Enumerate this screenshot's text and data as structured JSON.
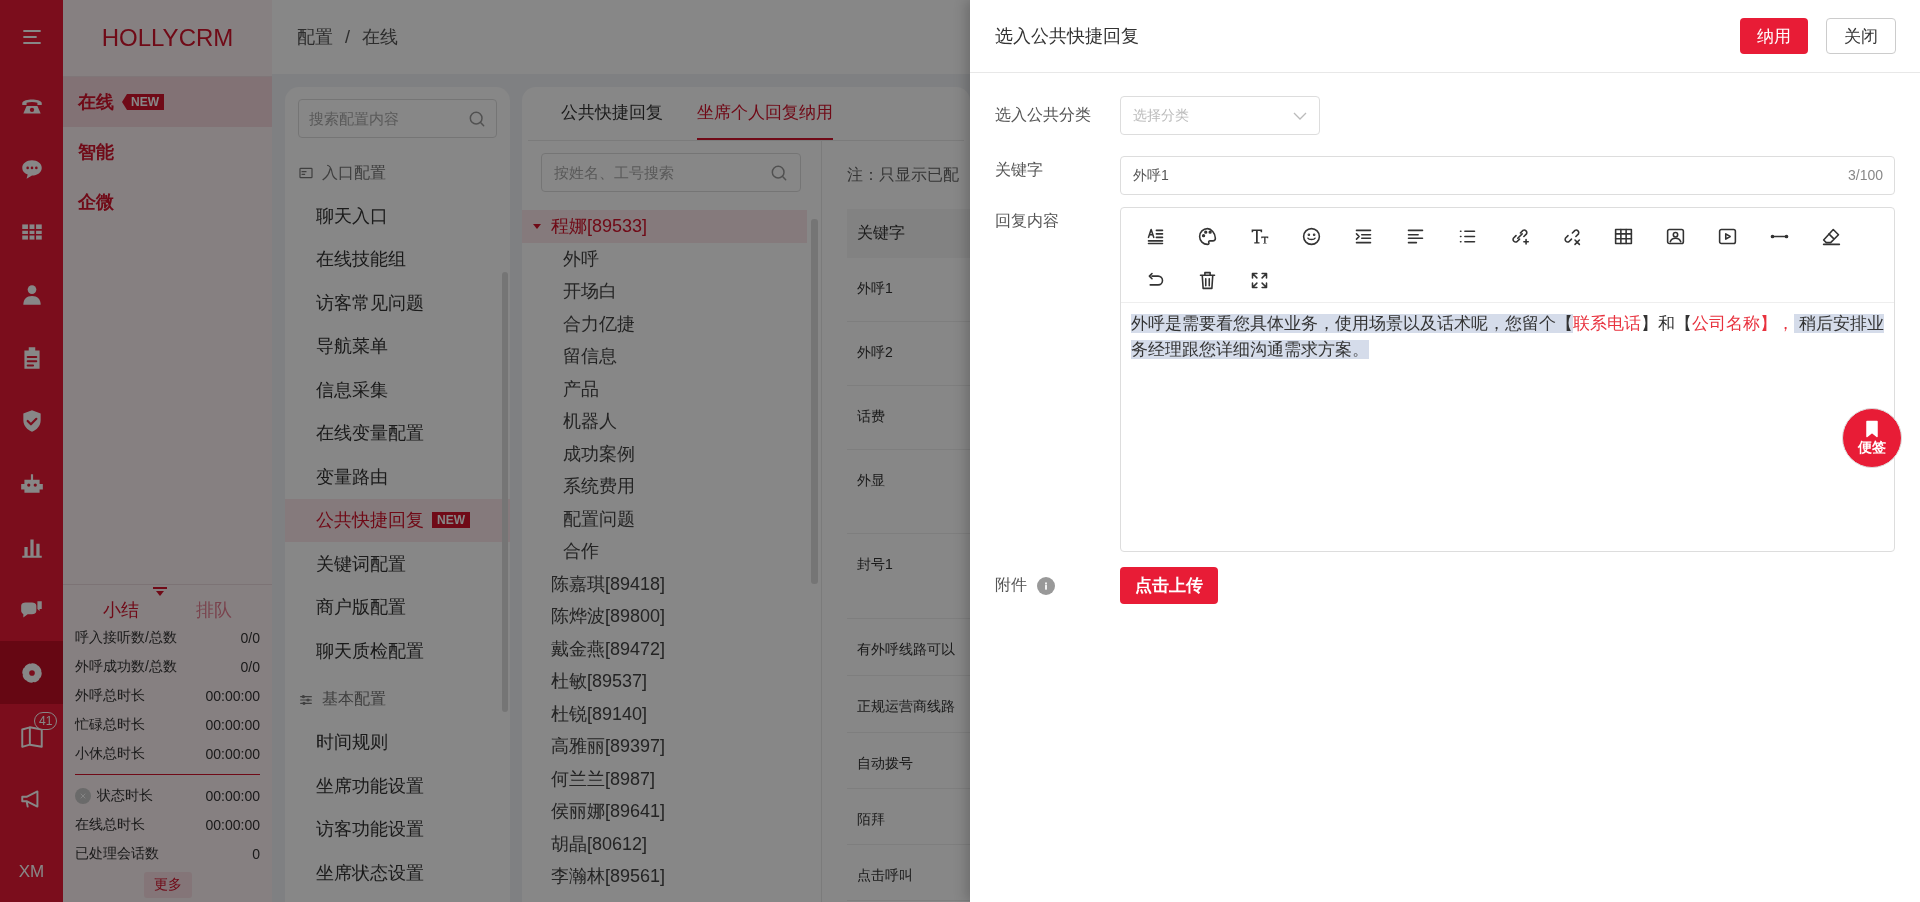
{
  "rail": {
    "items": [
      {
        "selected": false
      },
      {
        "selected": false
      },
      {
        "selected": false
      },
      {
        "selected": false
      },
      {
        "selected": false
      },
      {
        "selected": false
      },
      {
        "selected": false
      },
      {
        "selected": false
      },
      {
        "selected": false
      },
      {
        "selected": true
      },
      {
        "selected": false,
        "badge": "41"
      },
      {
        "selected": false
      }
    ],
    "user": "XM"
  },
  "side": {
    "logo": "HOLLYCRM",
    "items": [
      {
        "label": "在线",
        "badge": "NEW",
        "selected": true
      },
      {
        "label": "智能",
        "selected": false
      },
      {
        "label": "企微",
        "selected": false
      }
    ],
    "stats": {
      "tabs": [
        {
          "label": "小结",
          "selected": true
        },
        {
          "label": "排队",
          "selected": false
        }
      ],
      "summary": [
        {
          "label": "呼入接听数/总数",
          "value": "0/0"
        },
        {
          "label": "外呼成功数/总数",
          "value": "0/0"
        },
        {
          "label": "外呼总时长",
          "value": "00:00:00"
        },
        {
          "label": "忙碌总时长",
          "value": "00:00:00"
        },
        {
          "label": "小休总时长",
          "value": "00:00:00"
        }
      ],
      "session": [
        {
          "label": "状态时长",
          "value": "00:00:00",
          "kind": "status"
        },
        {
          "label": "在线总时长",
          "value": "00:00:00",
          "kind": "plain"
        },
        {
          "label": "已处理会话数",
          "value": "0",
          "kind": "plain"
        }
      ],
      "more": "更多"
    }
  },
  "breadcrumb": {
    "items": [
      "配置",
      "在线"
    ],
    "separator": "/"
  },
  "config_nav": {
    "search": {
      "placeholder": "搜索配置内容"
    },
    "groups": [
      {
        "title": "入口配置",
        "items": [
          {
            "label": "聊天入口",
            "selected": false
          },
          {
            "label": "在线技能组",
            "selected": false
          },
          {
            "label": "访客常见问题",
            "selected": false
          },
          {
            "label": "导航菜单",
            "selected": false
          },
          {
            "label": "信息采集",
            "selected": false
          },
          {
            "label": "在线变量配置",
            "selected": false
          },
          {
            "label": "变量路由",
            "selected": false
          },
          {
            "label": "公共快捷回复",
            "badge": "NEW",
            "selected": true
          },
          {
            "label": "关键词配置",
            "selected": false
          },
          {
            "label": "商户版配置",
            "selected": false
          },
          {
            "label": "聊天质检配置",
            "selected": false
          }
        ]
      },
      {
        "title": "基本配置",
        "items": [
          {
            "label": "时间规则",
            "selected": false
          },
          {
            "label": "坐席功能设置",
            "selected": false
          },
          {
            "label": "访客功能设置",
            "selected": false
          },
          {
            "label": "坐席状态设置",
            "selected": false
          }
        ]
      }
    ]
  },
  "agent_panel": {
    "tabs": [
      {
        "label": "公共快捷回复",
        "selected": false
      },
      {
        "label": "坐席个人回复纳用",
        "selected": true
      }
    ],
    "search": {
      "placeholder": "按姓名、工号搜索"
    },
    "tree": [
      {
        "label": "程娜[89533]",
        "selected": true,
        "expanded": true,
        "children": [
          {
            "label": "外呼",
            "selected": false
          },
          {
            "label": "开场白",
            "selected": false
          },
          {
            "label": "合力亿捷",
            "selected": false
          },
          {
            "label": "留信息",
            "selected": false
          },
          {
            "label": "产品",
            "selected": false
          },
          {
            "label": "机器人",
            "selected": false
          },
          {
            "label": "成功案例",
            "selected": false
          },
          {
            "label": "系统费用",
            "selected": false
          },
          {
            "label": "配置问题",
            "selected": false
          },
          {
            "label": "合作",
            "selected": false
          }
        ]
      },
      {
        "label": "陈嘉琪[89418]",
        "selected": false
      },
      {
        "label": "陈烨波[89800]",
        "selected": false
      },
      {
        "label": "戴金燕[89472]",
        "selected": false
      },
      {
        "label": "杜敏[89537]",
        "selected": false
      },
      {
        "label": "杜锐[89140]",
        "selected": false
      },
      {
        "label": "高雅丽[89397]",
        "selected": false
      },
      {
        "label": "何兰兰[8987]",
        "selected": false
      },
      {
        "label": "侯丽娜[89641]",
        "selected": false
      },
      {
        "label": "胡晶[80612]",
        "selected": false
      },
      {
        "label": "李瀚林[89561]",
        "selected": false
      }
    ],
    "note": "注：只显示已配",
    "table": {
      "columns": [
        "关键字"
      ],
      "rows": [
        [
          "外呼1"
        ],
        [
          "外呼2"
        ],
        [
          "话费"
        ],
        [
          "外显"
        ],
        [
          "封号1"
        ],
        [
          "有外呼线路可以"
        ],
        [
          "正规运营商线路"
        ],
        [
          "自动拨号"
        ],
        [
          "陌拜"
        ],
        [
          "点击呼叫"
        ]
      ]
    }
  },
  "drawer": {
    "title": "选入公共快捷回复",
    "buttons": [
      {
        "label": "纳用",
        "kind": "primary"
      },
      {
        "label": "关闭",
        "kind": "default"
      }
    ],
    "category": {
      "label": "选入公共分类",
      "placeholder": "选择分类"
    },
    "keyword": {
      "label": "关键字",
      "value": "外呼1",
      "counter": "3/100"
    },
    "content": {
      "label": "回复内容",
      "segments": [
        {
          "text": "外呼是需要看您具体业务，使用场景以及话术呢，您留个【",
          "kind": "plain",
          "highlighted": true
        },
        {
          "text": "联系电话",
          "kind": "variable",
          "highlighted": false
        },
        {
          "text": "】和【",
          "kind": "plain",
          "highlighted": false
        },
        {
          "text": "公司名称】，",
          "kind": "variable",
          "highlighted": false
        },
        {
          "text": " 稍后安排业务经理跟您详细沟通需求方案。",
          "kind": "plain",
          "highlighted": true
        }
      ]
    },
    "attachment": {
      "label": "附件",
      "button": "点击上传"
    },
    "note_button": {
      "label": "便签"
    }
  }
}
